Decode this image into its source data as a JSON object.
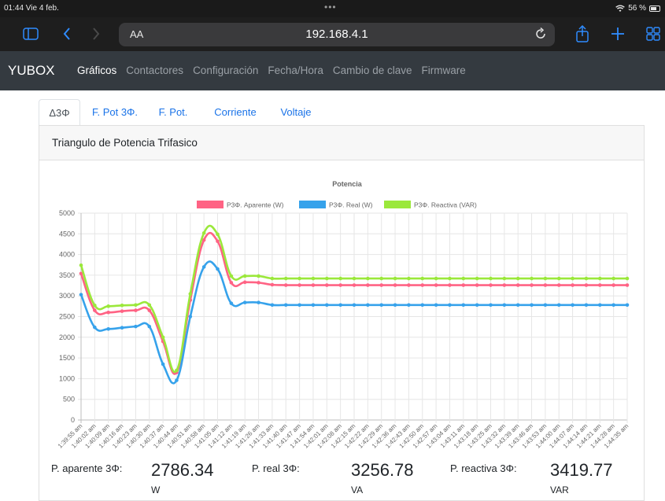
{
  "status_bar": {
    "time": "01:44  Vie 4 feb.",
    "battery": "56 %",
    "battery_level": 0.56
  },
  "browser": {
    "text_size": "AA",
    "url": "192.168.4.1"
  },
  "navbar": {
    "brand": "YUBOX",
    "links": [
      "Gráficos",
      "Contactores",
      "Configuración",
      "Fecha/Hora",
      "Cambio de clave",
      "Firmware"
    ],
    "active": "Gráficos"
  },
  "tabs": [
    {
      "label": "Δ3Φ",
      "active": true
    },
    {
      "label": "F. Pot 3Φ.",
      "active": false
    },
    {
      "label": "F. Pot.",
      "active": false
    },
    {
      "label": "Corriente",
      "active": false
    },
    {
      "label": "Voltaje",
      "active": false
    }
  ],
  "card": {
    "title": "Triangulo de Potencia Trifasico"
  },
  "chart_data": {
    "type": "line",
    "title": "Potencia",
    "ylim": [
      0,
      5000
    ],
    "yticks": [
      0,
      500,
      1000,
      1500,
      2000,
      2500,
      3000,
      3500,
      4000,
      4500,
      5000
    ],
    "grid": true,
    "legend_position": "top",
    "xticks": [
      "1:39:55 am",
      "1:40:02 am",
      "1:40:09 am",
      "1:40:16 am",
      "1:40:23 am",
      "1:40:30 am",
      "1:40:37 am",
      "1:40:44 am",
      "1:40:51 am",
      "1:40:58 am",
      "1:41:05 am",
      "1:41:12 am",
      "1:41:19 am",
      "1:41:26 am",
      "1:41:33 am",
      "1:41:40 am",
      "1:41:47 am",
      "1:41:54 am",
      "1:42:01 am",
      "1:42:08 am",
      "1:42:15 am",
      "1:42:22 am",
      "1:42:29 am",
      "1:42:36 am",
      "1:42:43 am",
      "1:42:50 am",
      "1:42:57 am",
      "1:43:04 am",
      "1:43:11 am",
      "1:43:18 am",
      "1:43:25 am",
      "1:43:32 am",
      "1:43:39 am",
      "1:43:46 am",
      "1:43:53 am",
      "1:44:00 am",
      "1:44:07 am",
      "1:44:14 am",
      "1:44:21 am",
      "1:44:28 am",
      "1:44:35 am"
    ],
    "series": [
      {
        "name": "P3Φ. Aparente (W)",
        "color": "#ff6384",
        "values": [
          3540,
          2650,
          2600,
          2630,
          2650,
          2650,
          1900,
          1150,
          2900,
          4350,
          4320,
          3320,
          3330,
          3320,
          3270,
          3260,
          3260,
          3260,
          3260,
          3260,
          3260,
          3260,
          3260,
          3260,
          3260,
          3260,
          3260,
          3260,
          3260,
          3260,
          3260,
          3260,
          3260,
          3260,
          3260,
          3260,
          3260,
          3260,
          3260,
          3260,
          3260
        ]
      },
      {
        "name": "P3Φ. Real (W)",
        "color": "#36a2eb",
        "values": [
          3030,
          2240,
          2200,
          2230,
          2260,
          2260,
          1350,
          960,
          2500,
          3700,
          3650,
          2820,
          2840,
          2840,
          2780,
          2780,
          2780,
          2780,
          2780,
          2780,
          2780,
          2780,
          2780,
          2780,
          2780,
          2780,
          2780,
          2780,
          2780,
          2780,
          2780,
          2780,
          2780,
          2780,
          2780,
          2780,
          2780,
          2780,
          2780,
          2780,
          2780
        ]
      },
      {
        "name": "P3Φ. Reactiva (VAR)",
        "color": "#9be83b",
        "values": [
          3740,
          2770,
          2750,
          2770,
          2780,
          2780,
          2000,
          1200,
          3050,
          4520,
          4490,
          3480,
          3480,
          3480,
          3420,
          3420,
          3420,
          3420,
          3420,
          3420,
          3420,
          3420,
          3420,
          3420,
          3420,
          3420,
          3420,
          3420,
          3420,
          3420,
          3420,
          3420,
          3420,
          3420,
          3420,
          3420,
          3420,
          3420,
          3420,
          3420,
          3420
        ]
      }
    ]
  },
  "summary": [
    {
      "label": "P. aparente 3Φ:",
      "value": "2786.34",
      "unit": "W"
    },
    {
      "label": "P. real 3Φ:",
      "value": "3256.78",
      "unit": "VA"
    },
    {
      "label": "P. reactiva 3Φ:",
      "value": "3419.77",
      "unit": "VAR"
    }
  ],
  "icons": [
    "sidebar-icon",
    "back-icon",
    "forward-icon",
    "reload-icon",
    "share-icon",
    "new-tab-icon",
    "tabs-grid-icon",
    "wifi-icon",
    "battery-icon"
  ]
}
